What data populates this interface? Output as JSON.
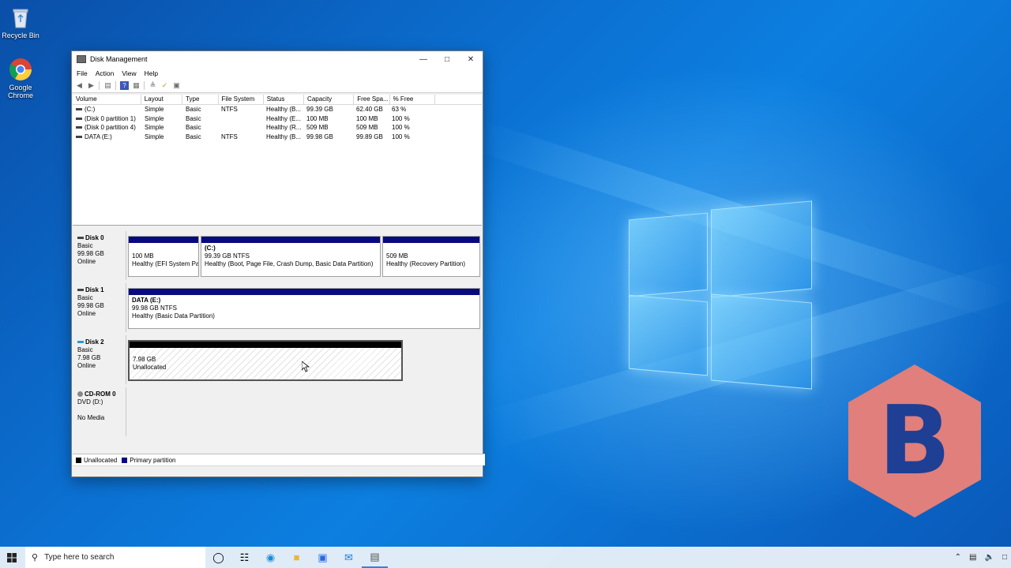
{
  "desktop": {
    "icons": [
      {
        "label": "Recycle Bin",
        "icon": "recycle-bin-icon"
      },
      {
        "label": "Google Chrome",
        "icon": "chrome-icon"
      }
    ],
    "badge_letter": "B",
    "badge_color": "#e07f7b",
    "badge_letter_color": "#1e3f94"
  },
  "window": {
    "title": "Disk Management",
    "menu": [
      "File",
      "Action",
      "View",
      "Help"
    ],
    "columns": [
      "Volume",
      "Layout",
      "Type",
      "File System",
      "Status",
      "Capacity",
      "Free Spa...",
      "% Free",
      ""
    ],
    "rows": [
      [
        "(C:)",
        "Simple",
        "Basic",
        "NTFS",
        "Healthy (B...",
        "99.39 GB",
        "62.40 GB",
        "63 %"
      ],
      [
        "(Disk 0 partition 1)",
        "Simple",
        "Basic",
        "",
        "Healthy (E...",
        "100 MB",
        "100 MB",
        "100 %"
      ],
      [
        "(Disk 0 partition 4)",
        "Simple",
        "Basic",
        "",
        "Healthy (R...",
        "509 MB",
        "509 MB",
        "100 %"
      ],
      [
        "DATA (E:)",
        "Simple",
        "Basic",
        "NTFS",
        "Healthy (B...",
        "99.98 GB",
        "99.89 GB",
        "100 %"
      ]
    ],
    "disks": [
      {
        "name": "Disk 0",
        "type": "Basic",
        "size": "99.98 GB",
        "state": "Online",
        "partitions": [
          {
            "title": "",
            "line1": "100 MB",
            "line2": "Healthy (EFI System Pa"
          },
          {
            "title": "(C:)",
            "line1": "99.39 GB NTFS",
            "line2": "Healthy (Boot, Page File, Crash Dump, Basic Data Partition)"
          },
          {
            "title": "",
            "line1": "509 MB",
            "line2": "Healthy (Recovery Partition)"
          }
        ]
      },
      {
        "name": "Disk 1",
        "type": "Basic",
        "size": "99.98 GB",
        "state": "Online",
        "partitions": [
          {
            "title": "DATA (E:)",
            "line1": "99.98 GB NTFS",
            "line2": "Healthy (Basic Data Partition)"
          }
        ]
      },
      {
        "name": "Disk 2",
        "type": "Basic",
        "size": "7.98 GB",
        "state": "Online",
        "partitions": [
          {
            "title": "",
            "line1": "7.98 GB",
            "line2": "Unallocated"
          }
        ]
      },
      {
        "name": "CD-ROM 0",
        "type": "DVD (D:)",
        "size": "",
        "state": "No Media",
        "partitions": []
      }
    ],
    "legend": [
      {
        "label": "Unallocated",
        "color": "#000000"
      },
      {
        "label": "Primary partition",
        "color": "#0a0a80"
      }
    ]
  },
  "taskbar": {
    "search_placeholder": "Type here to search"
  }
}
